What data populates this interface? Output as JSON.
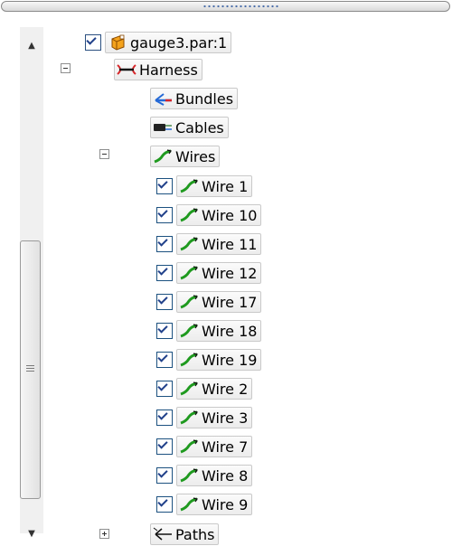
{
  "tree": {
    "root": {
      "label": "gauge3.par:1",
      "icon": "part-icon",
      "checked": true
    },
    "harness": {
      "label": "Harness",
      "icon": "harness-icon",
      "expanded": true
    },
    "bundles": {
      "label": "Bundles",
      "icon": "bundle-icon"
    },
    "cables": {
      "label": "Cables",
      "icon": "cable-icon"
    },
    "wires": {
      "label": "Wires",
      "icon": "wire-icon",
      "expanded": true
    },
    "wire_items": [
      {
        "label": "Wire 1",
        "checked": true
      },
      {
        "label": "Wire 10",
        "checked": true
      },
      {
        "label": "Wire 11",
        "checked": true
      },
      {
        "label": "Wire 12",
        "checked": true
      },
      {
        "label": "Wire 17",
        "checked": true
      },
      {
        "label": "Wire 18",
        "checked": true
      },
      {
        "label": "Wire 19",
        "checked": true
      },
      {
        "label": "Wire 2",
        "checked": true
      },
      {
        "label": "Wire 3",
        "checked": true
      },
      {
        "label": "Wire 7",
        "checked": true
      },
      {
        "label": "Wire 8",
        "checked": true
      },
      {
        "label": "Wire 9",
        "checked": true
      }
    ],
    "paths": {
      "label": "Paths",
      "icon": "path-icon",
      "expanded": false
    }
  },
  "colors": {
    "wire_green": "#1f9a1f",
    "harness_red": "#d8262a",
    "bundle_blue": "#2469d6",
    "checkbox_border": "#1c5180"
  }
}
